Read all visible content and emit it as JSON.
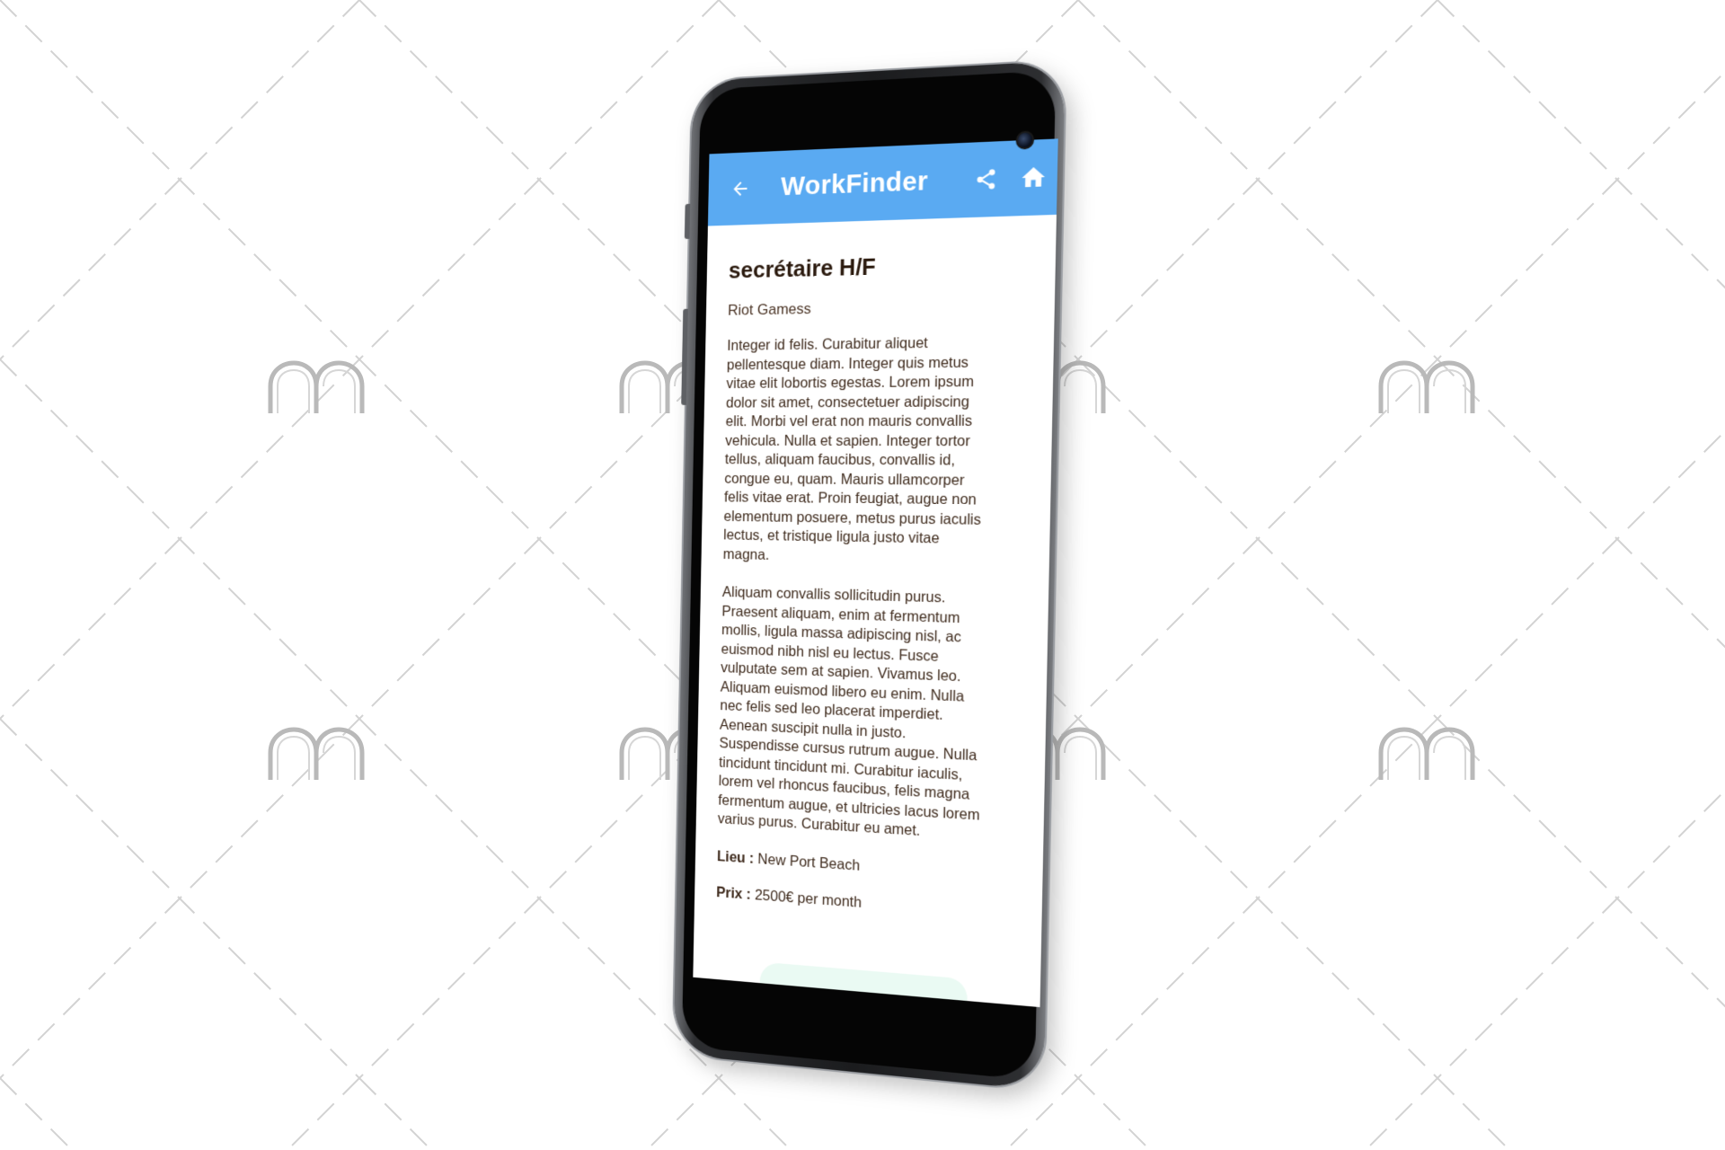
{
  "colors": {
    "appbar": "#5aaaf2",
    "text": "#3e2a1c",
    "pattern": "#d2d2d2",
    "watermark": "#b9b9b9"
  },
  "appbar": {
    "back_icon": "arrow-left-icon",
    "title": "WorkFinder",
    "share_icon": "share-icon",
    "home_icon": "home-icon"
  },
  "job": {
    "title": "secrétaire H/F",
    "company": "Riot Gamess",
    "description_1": "Integer id felis. Curabitur aliquet pellentesque diam. Integer quis metus vitae elit lobortis egestas. Lorem ipsum dolor sit amet, consectetuer adipiscing elit. Morbi vel erat non mauris convallis vehicula. Nulla et sapien. Integer tortor tellus, aliquam faucibus, convallis id, congue eu, quam. Mauris ullamcorper felis vitae erat. Proin feugiat, augue non elementum posuere, metus purus iaculis lectus, et tristique ligula justo vitae magna.",
    "description_2": "Aliquam convallis sollicitudin purus. Praesent aliquam, enim at fermentum mollis, ligula massa adipiscing nisl, ac euismod nibh nisl eu lectus. Fusce vulputate sem at sapien. Vivamus leo. Aliquam euismod libero eu enim. Nulla nec felis sed leo placerat imperdiet. Aenean suscipit nulla in justo. Suspendisse cursus rutrum augue. Nulla tincidunt tincidunt mi. Curabitur iaculis, lorem vel rhoncus faucibus, felis magna fermentum augue, et ultricies lacus lorem varius purus. Curabitur eu amet.",
    "location_label": "Lieu :",
    "location_value": "New Port Beach",
    "price_label": "Prix :",
    "price_value": "2500€ per month"
  }
}
